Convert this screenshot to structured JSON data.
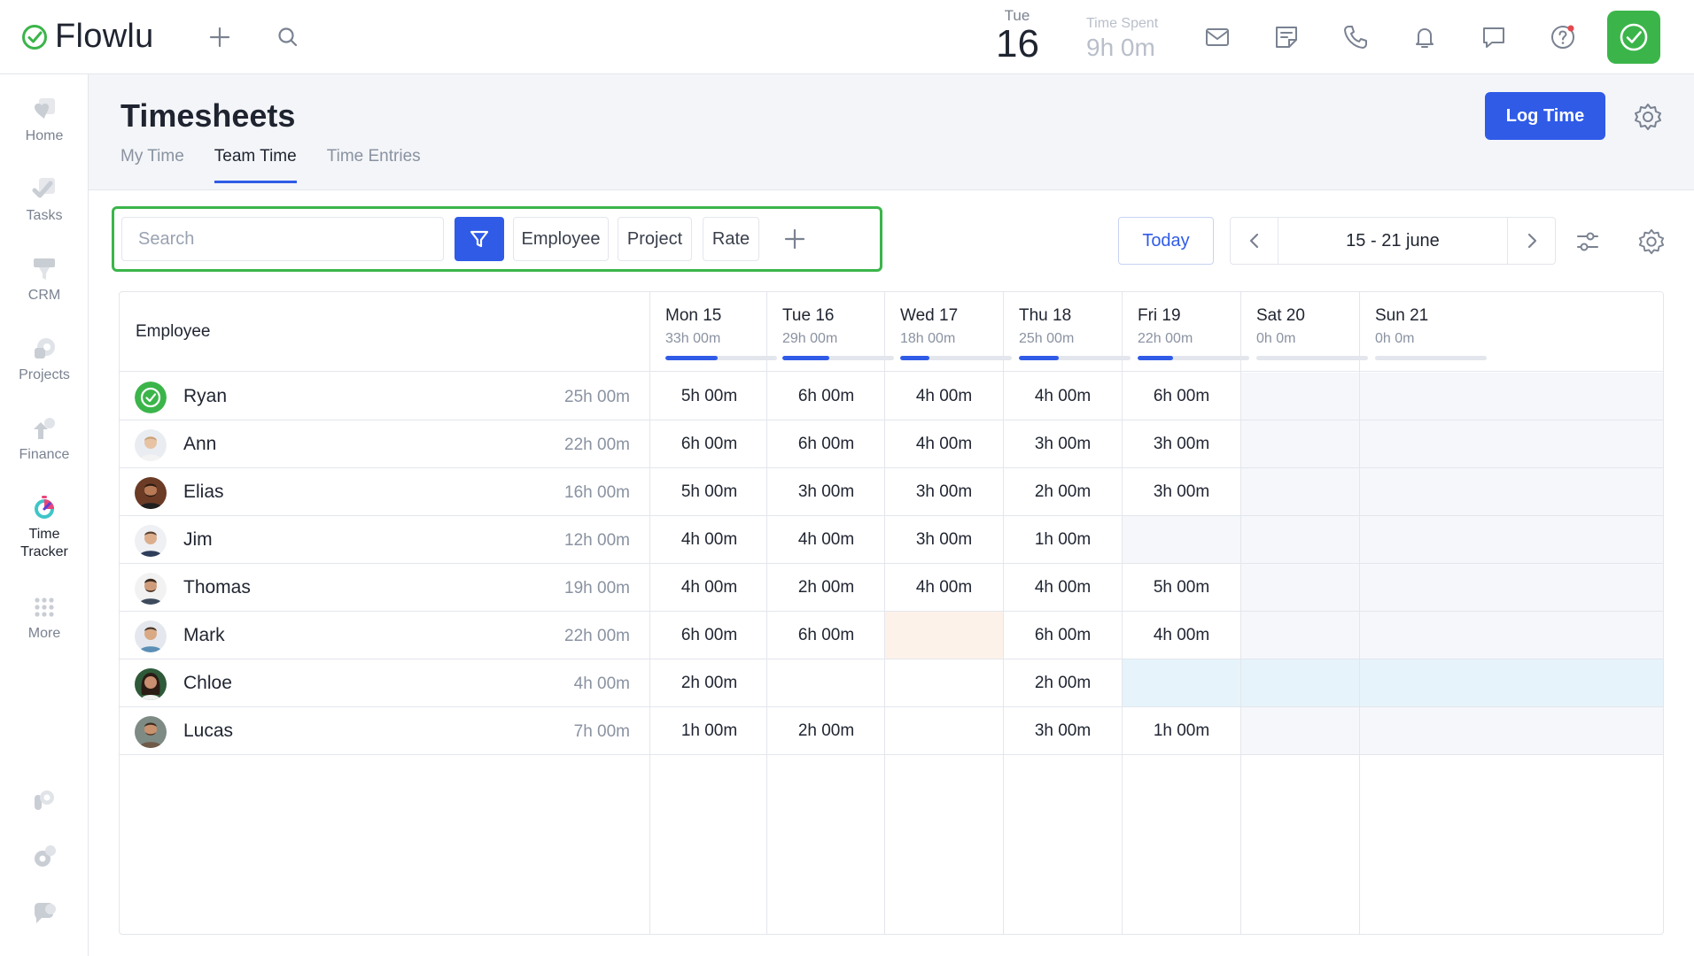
{
  "app": {
    "name": "Flowlu"
  },
  "topbar": {
    "date": {
      "dow": "Tue",
      "day": "16"
    },
    "time_spent": {
      "label": "Time Spent",
      "value": "9h 0m"
    },
    "icons": [
      "plus-icon",
      "search-icon",
      "mail-icon",
      "notes-icon",
      "phone-icon",
      "bell-icon",
      "chat-icon",
      "help-icon",
      "user-check-icon"
    ]
  },
  "sidebar": {
    "items": [
      {
        "label": "Home",
        "icon": "home-icon"
      },
      {
        "label": "Tasks",
        "icon": "tasks-icon"
      },
      {
        "label": "CRM",
        "icon": "crm-icon"
      },
      {
        "label": "Projects",
        "icon": "projects-icon"
      },
      {
        "label": "Finance",
        "icon": "finance-icon"
      },
      {
        "label": "Time\nTracker",
        "icon": "time-tracker-icon",
        "line1": "Time",
        "line2": "Tracker"
      },
      {
        "label": "More",
        "icon": "more-icon"
      }
    ]
  },
  "header": {
    "title": "Timesheets",
    "tabs": [
      {
        "label": "My Time",
        "active": false
      },
      {
        "label": "Team Time",
        "active": true
      },
      {
        "label": "Time Entries",
        "active": false
      }
    ],
    "log_time_label": "Log Time"
  },
  "filters": {
    "search_placeholder": "Search",
    "chips": [
      "Employee",
      "Project",
      "Rate"
    ]
  },
  "period": {
    "today_label": "Today",
    "range_label": "15 - 21 june"
  },
  "table": {
    "employee_header": "Employee",
    "days": [
      {
        "name": "Mon 15",
        "total": "33h 00m",
        "progress": 0.47
      },
      {
        "name": "Tue 16",
        "total": "29h 00m",
        "progress": 0.42
      },
      {
        "name": "Wed 17",
        "total": "18h 00m",
        "progress": 0.26
      },
      {
        "name": "Thu 18",
        "total": "25h 00m",
        "progress": 0.36
      },
      {
        "name": "Fri 19",
        "total": "22h 00m",
        "progress": 0.32
      },
      {
        "name": "Sat 20",
        "total": "0h 0m",
        "progress": 0
      },
      {
        "name": "Sun 21",
        "total": "0h 0m",
        "progress": 0
      }
    ],
    "rows": [
      {
        "name": "Ryan",
        "total": "25h 00m",
        "cells": [
          "5h 00m",
          "6h 00m",
          "4h 00m",
          "4h 00m",
          "6h 00m",
          "",
          ""
        ]
      },
      {
        "name": "Ann",
        "total": "22h 00m",
        "cells": [
          "6h 00m",
          "6h 00m",
          "4h 00m",
          "3h 00m",
          "3h 00m",
          "",
          ""
        ]
      },
      {
        "name": "Elias",
        "total": "16h 00m",
        "cells": [
          "5h 00m",
          "3h 00m",
          "3h 00m",
          "2h 00m",
          "3h 00m",
          "",
          ""
        ]
      },
      {
        "name": "Jim",
        "total": "12h 00m",
        "cells": [
          "4h 00m",
          "4h 00m",
          "3h 00m",
          "1h 00m",
          "",
          "",
          ""
        ]
      },
      {
        "name": "Thomas",
        "total": "19h 00m",
        "cells": [
          "4h 00m",
          "2h 00m",
          "4h 00m",
          "4h 00m",
          "5h 00m",
          "",
          ""
        ]
      },
      {
        "name": "Mark",
        "total": "22h 00m",
        "cells": [
          "6h 00m",
          "6h 00m",
          "",
          "6h 00m",
          "4h 00m",
          "",
          ""
        ]
      },
      {
        "name": "Chloe",
        "total": "4h 00m",
        "cells": [
          "2h 00m",
          "",
          "",
          "2h 00m",
          "",
          "",
          ""
        ]
      },
      {
        "name": "Lucas",
        "total": "7h 00m",
        "cells": [
          "1h 00m",
          "2h 00m",
          "",
          "3h 00m",
          "1h 00m",
          "",
          ""
        ]
      }
    ]
  },
  "colors": {
    "accent": "#2f5be7",
    "brand_green": "#3bb54a",
    "missing_cell": "#fdf2e9",
    "leave_cell": "#e6f3fb",
    "weekend_cell": "#f5f7fb"
  }
}
